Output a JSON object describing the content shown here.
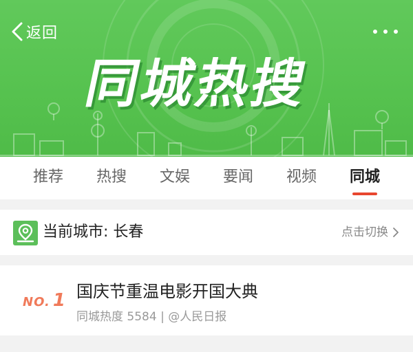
{
  "header": {
    "back_label": "返回",
    "banner_title": "同城热搜",
    "accent_green": "#56c24f",
    "more_icon": "more-dots-icon"
  },
  "tabs": [
    {
      "label": "推荐",
      "active": false
    },
    {
      "label": "热搜",
      "active": false
    },
    {
      "label": "文娱",
      "active": false
    },
    {
      "label": "要闻",
      "active": false
    },
    {
      "label": "视频",
      "active": false
    },
    {
      "label": "同城",
      "active": true
    }
  ],
  "tab_underline_color": "#e8462f",
  "city": {
    "label": "当前城市: 长春",
    "switch_label": "点击切换",
    "icon": "location-pin-icon"
  },
  "news": [
    {
      "rank_prefix": "NO.",
      "rank": "1",
      "title": "国庆节重温电影开国大典",
      "meta": "同城热度 5584 | @人民日报"
    }
  ]
}
